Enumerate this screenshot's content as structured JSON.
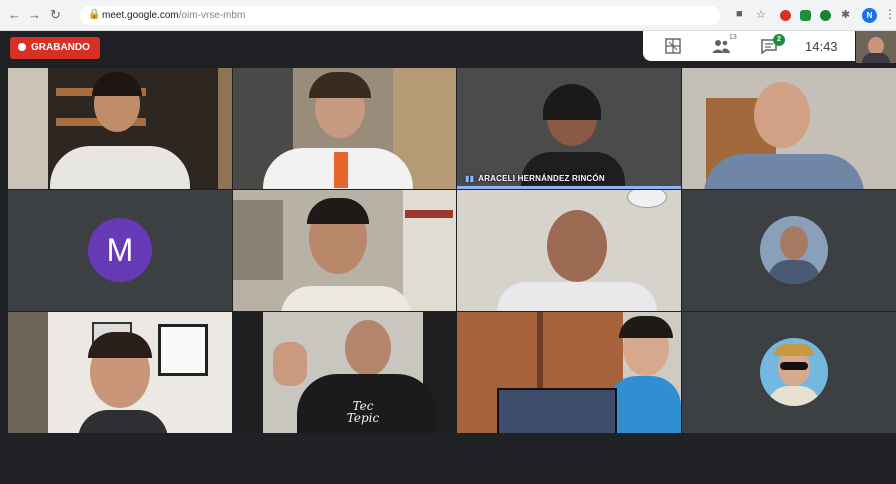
{
  "browser": {
    "url_host": "meet.google.com",
    "url_path": "/oim-vrse-mbm",
    "profile_letter": "N",
    "back_icon": "arrow-left-icon",
    "forward_icon": "arrow-right-icon",
    "reload_icon": "reload-icon"
  },
  "meet": {
    "recording_label": "GRABANDO",
    "participants_badge": "13",
    "chat_badge": "2",
    "clock": "14:43",
    "accent": "#8ab4f8",
    "recording_color": "#d93025"
  },
  "tiles": {
    "speaker_name": "ARACELI HERNÁNDEZ RINCÓN",
    "avatar_letter": "M",
    "shirt_text_1": "Tec",
    "shirt_text_2": "Tepic"
  }
}
